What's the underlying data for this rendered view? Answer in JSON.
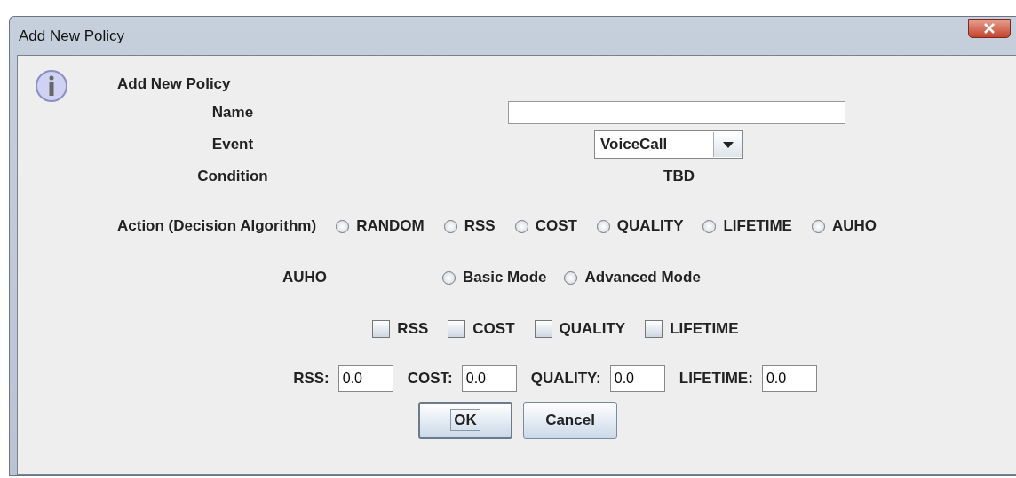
{
  "window": {
    "title": "Add New Policy"
  },
  "heading": "Add New Policy",
  "fields": [
    {
      "kind": "text",
      "label": "Name"
    },
    {
      "kind": "dropdown",
      "label": "Event",
      "value": "VoiceCall"
    },
    {
      "kind": "static",
      "label": "Condition",
      "value": "TBD"
    }
  ],
  "action": {
    "label": "Action (Decision Algorithm)",
    "options": [
      {
        "label": "RANDOM",
        "selected": false
      },
      {
        "label": "RSS",
        "selected": false
      },
      {
        "label": "COST",
        "selected": false
      },
      {
        "label": "QUALITY",
        "selected": false
      },
      {
        "label": "LIFETIME",
        "selected": false
      },
      {
        "label": "AUHO",
        "selected": false
      }
    ]
  },
  "auho": {
    "label": "AUHO",
    "options": [
      {
        "label": "Basic Mode",
        "selected": false
      },
      {
        "label": "Advanced Mode",
        "selected": false
      }
    ]
  },
  "criteria": [
    {
      "label": "RSS",
      "checked": false
    },
    {
      "label": "COST",
      "checked": false
    },
    {
      "label": "QUALITY",
      "checked": false
    },
    {
      "label": "LIFETIME",
      "checked": false
    }
  ],
  "weights": [
    {
      "label": "RSS:",
      "value": "0.0"
    },
    {
      "label": "COST:",
      "value": "0.0"
    },
    {
      "label": "QUALITY:",
      "value": "0.0"
    },
    {
      "label": "LIFETIME:",
      "value": "0.0"
    }
  ],
  "buttons": [
    {
      "label": "OK",
      "focused": true
    },
    {
      "label": "Cancel",
      "focused": false
    }
  ]
}
